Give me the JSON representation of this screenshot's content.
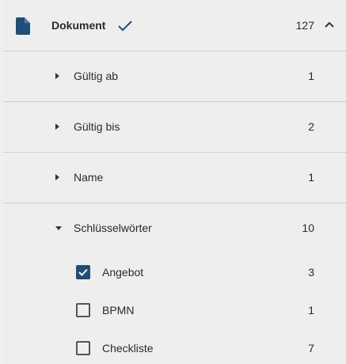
{
  "header": {
    "icon": "document-icon",
    "label": "Dokument",
    "selected_icon": "check-icon",
    "count": "127",
    "toggle_icon": "chevron-up-icon",
    "accent": "#1f4e79"
  },
  "facets": [
    {
      "label": "Gültig ab",
      "count": "1",
      "expanded": false
    },
    {
      "label": "Gültig bis",
      "count": "2",
      "expanded": false
    },
    {
      "label": "Name",
      "count": "1",
      "expanded": false
    },
    {
      "label": "Schlüsselwörter",
      "count": "10",
      "expanded": true
    }
  ],
  "options": [
    {
      "label": "Angebot",
      "count": "3",
      "checked": true
    },
    {
      "label": "BPMN",
      "count": "1",
      "checked": false
    },
    {
      "label": "Checkliste",
      "count": "7",
      "checked": false
    }
  ]
}
